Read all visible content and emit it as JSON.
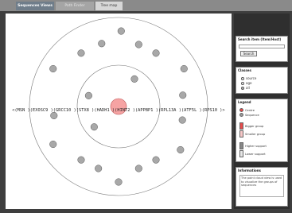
{
  "tabs": [
    {
      "label": "Sequences Views",
      "state": "active"
    },
    {
      "label": "Path Finder",
      "state": "inactive"
    },
    {
      "label": "Tree map",
      "state": "plain"
    }
  ],
  "visualization": {
    "sequence_text": "<(MSN )(EXOSC9 )(GRCC10 )(STX8 )(HADH1 )(HINT2 )(APPBP1 )(RPL13A )(ATF5L )(RPS10 )>",
    "center_color": "#f6a3a3",
    "node_color": "#a8a8a8",
    "ring_color": "#777777"
  },
  "search_panel": {
    "title": "Search item (Item/Host)",
    "input_value": "",
    "button_label": "Search"
  },
  "classes_panel": {
    "title": "Classes",
    "options": [
      {
        "label": "source",
        "checked": false
      },
      {
        "label": "age",
        "checked": false
      },
      {
        "label": "all",
        "checked": true
      }
    ]
  },
  "legend_panel": {
    "title": "Legend",
    "items": [
      {
        "label": "Centre",
        "color": "#ee4444",
        "shape": "circle"
      },
      {
        "label": "Sequence",
        "color": "#999999",
        "shape": "circle"
      },
      {
        "label": "Bigger group",
        "color": "#e84c4c",
        "shape": "square"
      },
      {
        "label": "Smaller group",
        "color": "#f7c8c8",
        "shape": "square"
      },
      {
        "label": "Higher support",
        "color": "#888888",
        "shape": "square"
      },
      {
        "label": "Lower support",
        "color": "#e6e6e6",
        "shape": "square"
      }
    ]
  },
  "info_panel": {
    "title": "Informations",
    "text": "The point cloud view is used to visualize the groups of sequences"
  }
}
